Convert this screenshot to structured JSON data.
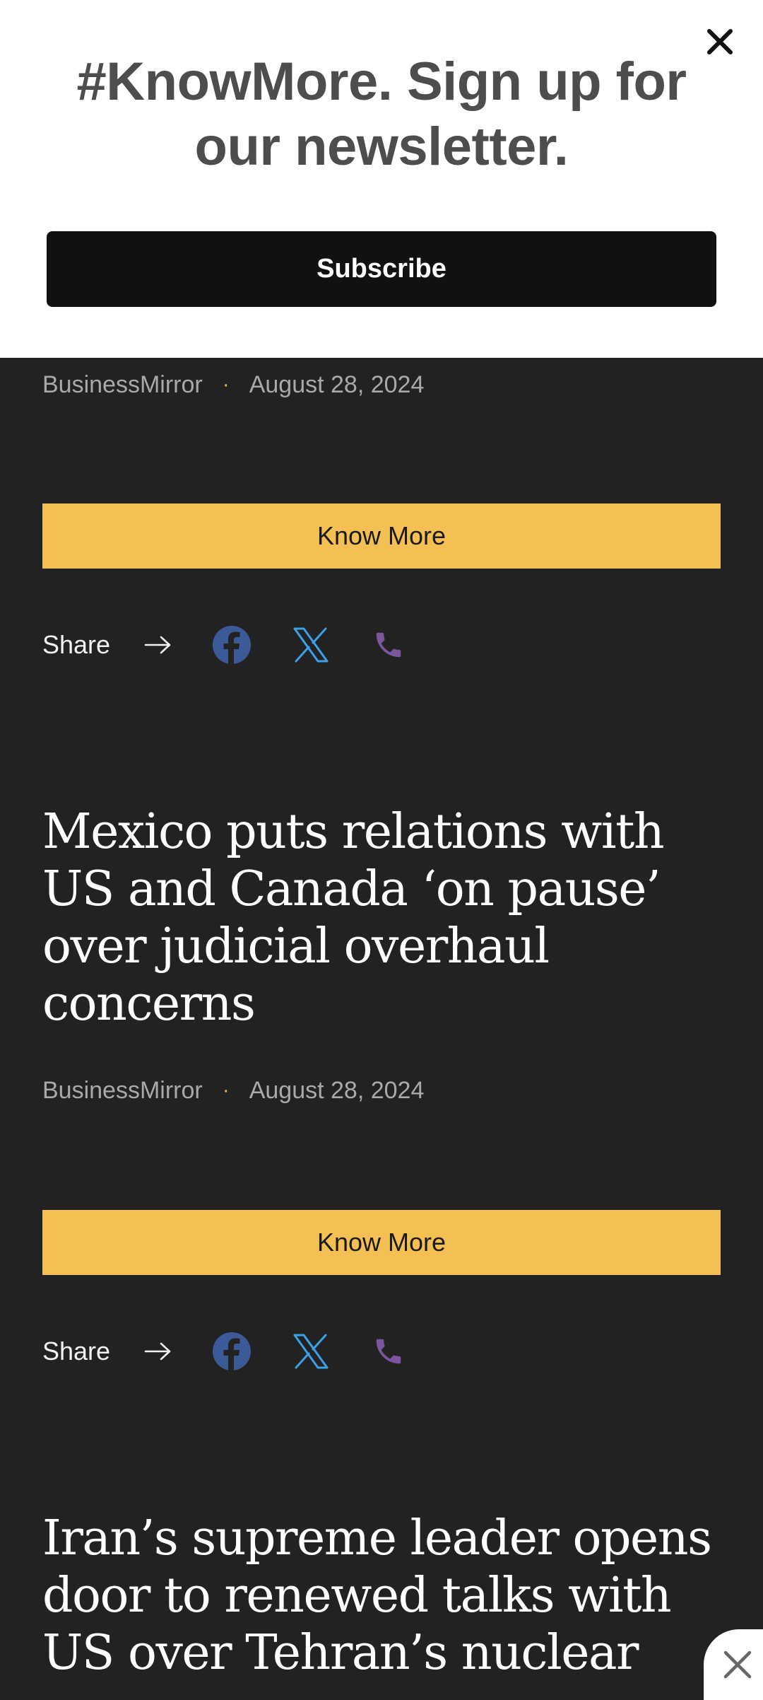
{
  "newsletter": {
    "title": "#KnowMore. Sign up for our newsletter.",
    "subscribe_label": "Subscribe",
    "close_icon": "close-icon"
  },
  "articles": [
    {
      "source": "BusinessMirror",
      "separator": "·",
      "date": "August 28, 2024",
      "know_more_label": "Know More",
      "share_label": "Share"
    },
    {
      "headline": "Mexico puts relations with US and Canada ‘on pause’ over judicial overhaul concerns",
      "source": "BusinessMirror",
      "separator": "·",
      "date": "August 28, 2024",
      "know_more_label": "Know More",
      "share_label": "Share"
    },
    {
      "headline": "Iran’s supreme leader opens door to renewed talks with US over Tehran’s nuclear"
    }
  ],
  "share_icons": [
    "facebook-icon",
    "x-icon",
    "phone-icon"
  ],
  "colors": {
    "background": "#222223",
    "accent_yellow": "#f5c053",
    "facebook_blue": "#3d5a98",
    "x_blue": "#3aa0e8",
    "phone_purple": "#7b559e"
  }
}
